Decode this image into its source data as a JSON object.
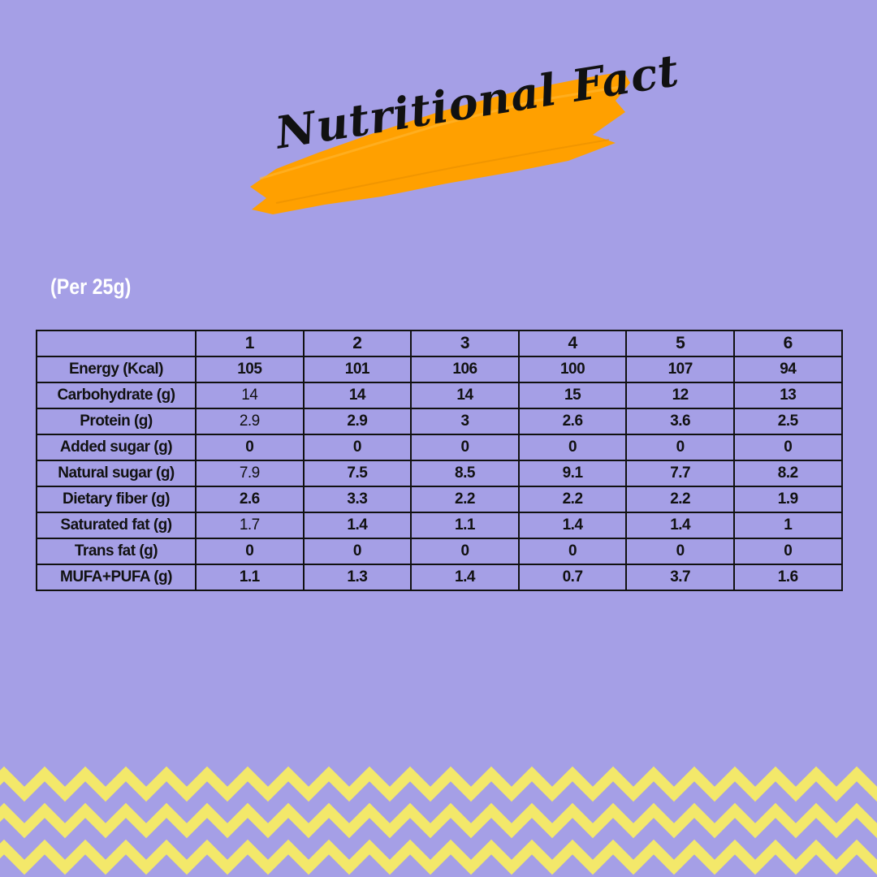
{
  "colors": {
    "background": "#a59fe6",
    "brush": "#ffa000",
    "zigzag": "#f3e86a",
    "text": "#111111"
  },
  "title": "Nutritional Fact",
  "serving": "(Per 25g)",
  "table": {
    "columns": [
      "",
      "1",
      "2",
      "3",
      "4",
      "5",
      "6"
    ],
    "rows": [
      {
        "label": "Energy (Kcal)",
        "values": [
          "105",
          "101",
          "106",
          "100",
          "107",
          "94"
        ]
      },
      {
        "label": "Carbohydrate (g)",
        "values": [
          "14",
          "14",
          "14",
          "15",
          "12",
          "13"
        ]
      },
      {
        "label": "Protein (g)",
        "values": [
          "2.9",
          "2.9",
          "3",
          "2.6",
          "3.6",
          "2.5"
        ]
      },
      {
        "label": "Added sugar (g)",
        "values": [
          "0",
          "0",
          "0",
          "0",
          "0",
          "0"
        ]
      },
      {
        "label": "Natural sugar (g)",
        "values": [
          "7.9",
          "7.5",
          "8.5",
          "9.1",
          "7.7",
          "8.2"
        ]
      },
      {
        "label": "Dietary fiber (g)",
        "values": [
          "2.6",
          "3.3",
          "2.2",
          "2.2",
          "2.2",
          "1.9"
        ]
      },
      {
        "label": "Saturated fat (g)",
        "values": [
          "1.7",
          "1.4",
          "1.1",
          "1.4",
          "1.4",
          "1"
        ]
      },
      {
        "label": "Trans fat (g)",
        "values": [
          "0",
          "0",
          "0",
          "0",
          "0",
          "0"
        ]
      },
      {
        "label": "MUFA+PUFA (g)",
        "values": [
          "1.1",
          "1.3",
          "1.4",
          "0.7",
          "3.7",
          "1.6"
        ]
      }
    ]
  }
}
